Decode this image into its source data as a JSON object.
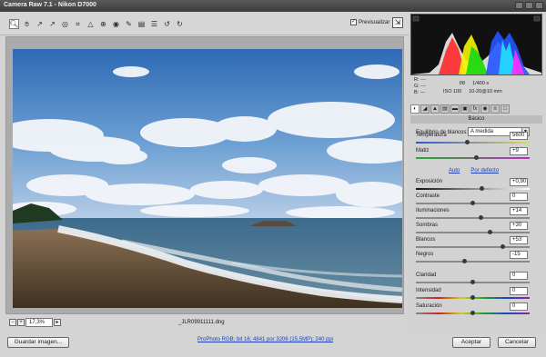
{
  "window": {
    "title": "Camera Raw 7.1 - Nikon D7000"
  },
  "toolbar": {
    "tools": [
      "zoom-icon",
      "hand-icon",
      "white-balance-icon",
      "color-sampler-icon",
      "target-adjust-icon",
      "crop-icon",
      "straighten-icon",
      "spot-removal-icon",
      "red-eye-icon",
      "adjustment-brush-icon",
      "graduated-filter-icon",
      "preferences-icon",
      "rotate-left-icon",
      "rotate-right-icon"
    ],
    "preview_label": "Previsualizar",
    "preview_checked": true
  },
  "image": {
    "zoom": "17,3%",
    "filename": "_JLR09911111.dng"
  },
  "readout": {
    "r": "R:  ---",
    "g": "G:  ---",
    "b": "B:  ---",
    "aperture": "f/8",
    "shutter": "1/400 s",
    "iso": "ISO 100",
    "lens": "10-20@10 mm"
  },
  "panel": {
    "section_title": "Básico",
    "white_balance_label": "Equilibrio de blancos:",
    "white_balance_value": "A medida",
    "auto_link": "Auto",
    "default_link": "Por defecto",
    "sliders": [
      {
        "label": "Temperatura",
        "value": "5600",
        "pos": 0.45
      },
      {
        "label": "Matiz",
        "value": "+9",
        "pos": 0.53
      },
      {
        "label": "Exposición",
        "value": "+0,90",
        "pos": 0.58
      },
      {
        "label": "Contraste",
        "value": "0",
        "pos": 0.5
      },
      {
        "label": "Iluminaciones",
        "value": "+14",
        "pos": 0.57
      },
      {
        "label": "Sombras",
        "value": "+30",
        "pos": 0.65
      },
      {
        "label": "Blancos",
        "value": "+53",
        "pos": 0.76
      },
      {
        "label": "Negros",
        "value": "-15",
        "pos": 0.43
      },
      {
        "label": "Claridad",
        "value": "0",
        "pos": 0.5
      },
      {
        "label": "Intensidad",
        "value": "0",
        "pos": 0.5
      },
      {
        "label": "Saturación",
        "value": "0",
        "pos": 0.5
      }
    ]
  },
  "footer": {
    "save_label": "Guardar imagen...",
    "workflow_link": "ProPhoto RGB; bit 16; 4841 por 3206 (15,5MP); 240 ppi",
    "accept_label": "Aceptar",
    "cancel_label": "Cancelar"
  }
}
